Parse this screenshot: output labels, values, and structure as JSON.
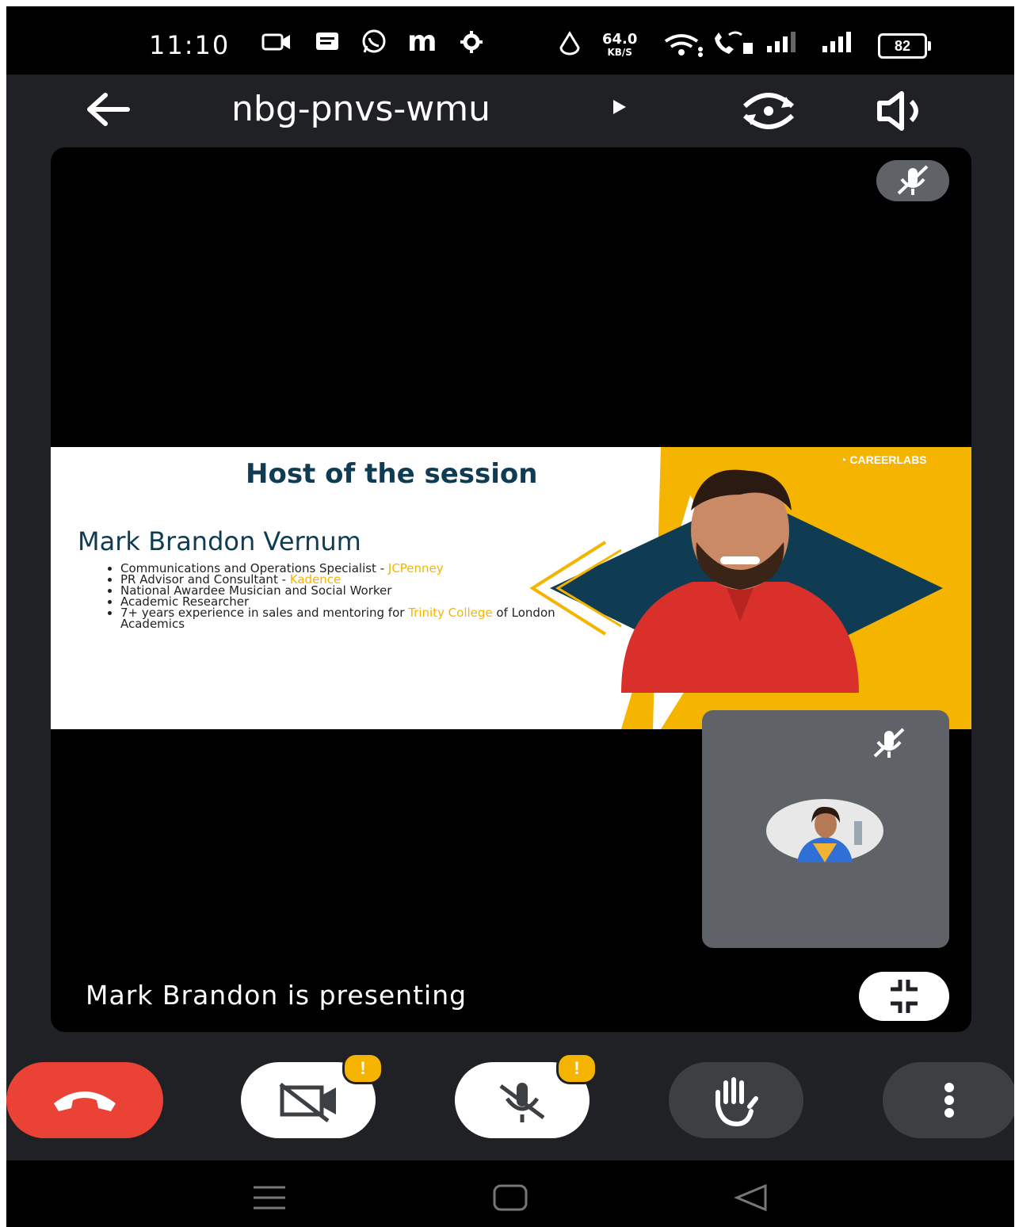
{
  "status_bar": {
    "time": "11:10",
    "network_speed_value": "64.0",
    "network_speed_unit": "KB/S",
    "battery": "82",
    "icons": [
      "video-notification-icon",
      "message-icon",
      "whatsapp-icon",
      "m-app-icon",
      "settings-icon",
      "alarm-icon",
      "wifi-icon",
      "wifi-calling-icon",
      "signal-icon",
      "signal-icon"
    ]
  },
  "top_bar": {
    "meeting_code": "nbg-pnvs-wmu",
    "icons": [
      "back-arrow-icon",
      "play-arrow-icon",
      "switch-camera-icon",
      "speaker-icon"
    ]
  },
  "slide": {
    "heading": "Host of the session",
    "brand": "CAREERLABS",
    "host_name": "Mark Brandon Vernum",
    "bullets": [
      {
        "text": "Communications and Operations Specialist - ",
        "highlight": "JCPenney",
        "suffix": ""
      },
      {
        "text": "PR Advisor and Consultant - ",
        "highlight": "Kadence",
        "suffix": ""
      },
      {
        "text": "National Awardee Musician and Social Worker",
        "highlight": "",
        "suffix": ""
      },
      {
        "text": "Academic Researcher",
        "highlight": "",
        "suffix": ""
      },
      {
        "text": "7+ years experience in sales and mentoring for ",
        "highlight": "Trinity College",
        "suffix": " of London Academics"
      }
    ],
    "colors": {
      "navy": "#0f3b53",
      "yellow": "#f5b400",
      "shirt": "#d9302c"
    }
  },
  "presenting_text": "Mark Brandon is presenting",
  "controls": {
    "items": [
      "end-call",
      "camera-off",
      "mic-off",
      "raise-hand",
      "more-options"
    ],
    "warning_badge": "!",
    "colors": {
      "end_call": "#ea4335",
      "active_bg": "#ffffff",
      "inactive_bg": "#3c4043"
    }
  },
  "nav_bar": {
    "items": [
      "recent-apps",
      "home",
      "back"
    ]
  }
}
